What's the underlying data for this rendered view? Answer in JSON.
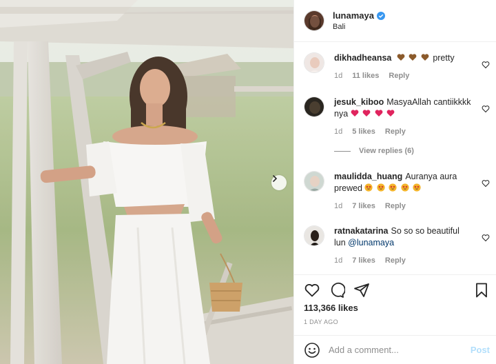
{
  "post": {
    "username": "lunamaya",
    "location": "Bali",
    "verified": true,
    "likes": "113,366 likes",
    "date": "1 DAY AGO",
    "comment_placeholder": "Add a comment...",
    "post_label": "Post"
  },
  "comments": [
    {
      "username": "dikhadheansa",
      "text": "pretty",
      "emoji": [
        "brown-heart",
        "brown-heart",
        "brown-heart"
      ],
      "emoji_position": "before",
      "age": "1d",
      "likes": "11 likes",
      "reply": "Reply"
    },
    {
      "username": "jesuk_kiboo",
      "text": "MasyaAllah cantiikkkk nya",
      "emoji": [
        "red-heart",
        "red-heart",
        "red-heart",
        "red-heart"
      ],
      "emoji_position": "after",
      "age": "1d",
      "likes": "5 likes",
      "reply": "Reply"
    },
    {
      "username": "maulidda_huang",
      "text": "Auranya aura prewed",
      "emoji": [
        "star-struck",
        "star-struck",
        "star-struck",
        "star-struck",
        "star-struck"
      ],
      "emoji_position": "after",
      "age": "1d",
      "likes": "7 likes",
      "reply": "Reply"
    },
    {
      "username": "ratnakatarina",
      "text": "So so so beautiful lun",
      "mention": "@lunamaya",
      "age": "1d",
      "likes": "7 likes",
      "reply": "Reply"
    }
  ],
  "view_replies": "View replies (6)",
  "icons": {
    "like": "heart-icon",
    "comment": "comment-icon",
    "share": "share-icon",
    "save": "bookmark-icon",
    "emoji": "smile-icon",
    "next": "chevron-right-icon",
    "verified": "verified-badge-icon"
  },
  "colors": {
    "text": "#262626",
    "secondary": "#8e8e8e",
    "verified": "#3897f0",
    "post_disabled": "#b2dffc",
    "mention": "#00376b",
    "red_heart": "#e0245e",
    "brown_heart": "#8b5a2b"
  }
}
